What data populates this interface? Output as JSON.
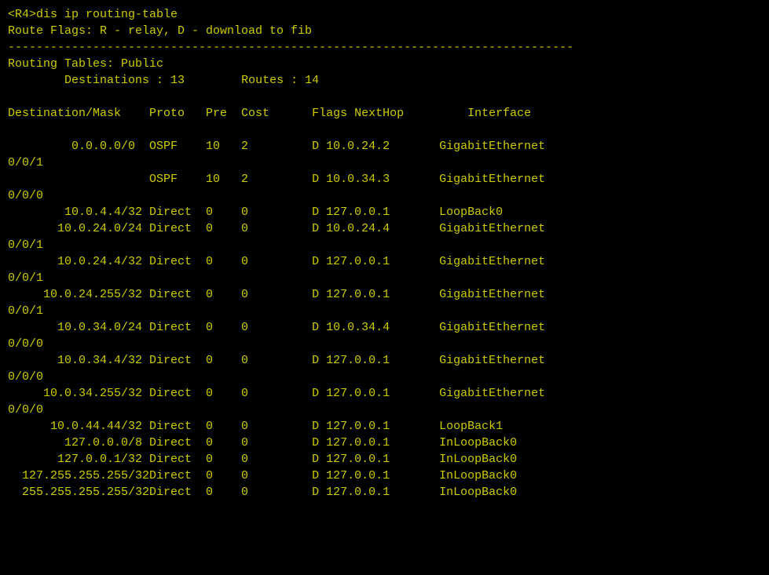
{
  "terminal": {
    "prompt_line": "<R4>dis ip routing-table",
    "route_flags": "Route Flags: R - relay, D - download to fib",
    "separator": "--------------------------------------------------------------------------------",
    "routing_tables_label": "Routing Tables: Public",
    "destinations_label": "        Destinations : 13",
    "routes_label": "Routes : 14",
    "col_header": "Destination/Mask    Proto   Pre  Cost      Flags NextHop         Interface",
    "rows": [
      {
        "dest": "         0.0.0.0/0",
        "proto": "OSPF",
        "pre": "10",
        "cost": "2",
        "flags": "D",
        "nexthop": "10.0.24.2",
        "interface": "GigabitEthernet",
        "iface2": "0/0/1"
      },
      {
        "dest": "                  ",
        "proto": "OSPF",
        "pre": "10",
        "cost": "2",
        "flags": "D",
        "nexthop": "10.0.34.3",
        "interface": "GigabitEthernet",
        "iface2": "0/0/0"
      },
      {
        "dest": "        10.0.4.4/32",
        "proto": "Direct",
        "pre": "0",
        "cost": "0",
        "flags": "D",
        "nexthop": "127.0.0.1",
        "interface": "LoopBack0",
        "iface2": ""
      },
      {
        "dest": "       10.0.24.0/24",
        "proto": "Direct",
        "pre": "0",
        "cost": "0",
        "flags": "D",
        "nexthop": "10.0.24.4",
        "interface": "GigabitEthernet",
        "iface2": "0/0/1"
      },
      {
        "dest": "       10.0.24.4/32",
        "proto": "Direct",
        "pre": "0",
        "cost": "0",
        "flags": "D",
        "nexthop": "127.0.0.1",
        "interface": "GigabitEthernet",
        "iface2": "0/0/1"
      },
      {
        "dest": "     10.0.24.255/32",
        "proto": "Direct",
        "pre": "0",
        "cost": "0",
        "flags": "D",
        "nexthop": "127.0.0.1",
        "interface": "GigabitEthernet",
        "iface2": "0/0/1"
      },
      {
        "dest": "       10.0.34.0/24",
        "proto": "Direct",
        "pre": "0",
        "cost": "0",
        "flags": "D",
        "nexthop": "10.0.34.4",
        "interface": "GigabitEthernet",
        "iface2": "0/0/0"
      },
      {
        "dest": "       10.0.34.4/32",
        "proto": "Direct",
        "pre": "0",
        "cost": "0",
        "flags": "D",
        "nexthop": "127.0.0.1",
        "interface": "GigabitEthernet",
        "iface2": "0/0/0"
      },
      {
        "dest": "     10.0.34.255/32",
        "proto": "Direct",
        "pre": "0",
        "cost": "0",
        "flags": "D",
        "nexthop": "127.0.0.1",
        "interface": "GigabitEthernet",
        "iface2": "0/0/0"
      },
      {
        "dest": "      10.0.44.44/32",
        "proto": "Direct",
        "pre": "0",
        "cost": "0",
        "flags": "D",
        "nexthop": "127.0.0.1",
        "interface": "LoopBack1",
        "iface2": ""
      },
      {
        "dest": "        127.0.0.0/8",
        "proto": "Direct",
        "pre": "0",
        "cost": "0",
        "flags": "D",
        "nexthop": "127.0.0.1",
        "interface": "InLoopBack0",
        "iface2": ""
      },
      {
        "dest": "       127.0.0.1/32",
        "proto": "Direct",
        "pre": "0",
        "cost": "0",
        "flags": "D",
        "nexthop": "127.0.0.1",
        "interface": "InLoopBack0",
        "iface2": ""
      },
      {
        "dest": "  127.255.255.255/32",
        "proto": "Direct",
        "pre": "0",
        "cost": "0",
        "flags": "D",
        "nexthop": "127.0.0.1",
        "interface": "InLoopBack0",
        "iface2": ""
      },
      {
        "dest": "  255.255.255.255/32",
        "proto": "Direct",
        "pre": "0",
        "cost": "0",
        "flags": "D",
        "nexthop": "127.0.0.1",
        "interface": "InLoopBack0",
        "iface2": ""
      }
    ]
  }
}
